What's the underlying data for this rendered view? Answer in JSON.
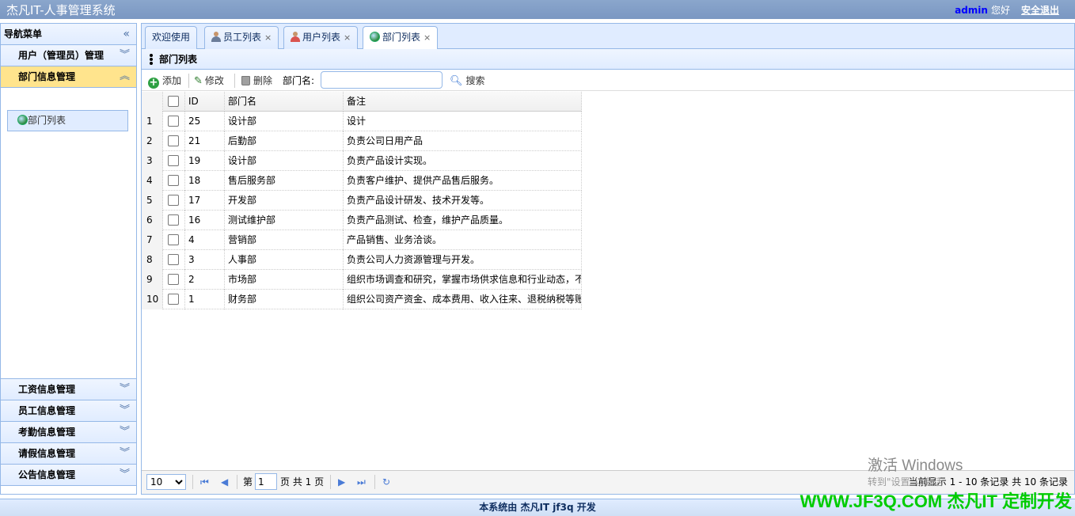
{
  "header": {
    "title": "杰凡IT-人事管理系统",
    "user": "admin",
    "greeting": "您好",
    "logout": "安全退出"
  },
  "sidebar": {
    "title": "导航菜单",
    "sections": [
      {
        "label": "用户（管理员）管理"
      },
      {
        "label": "部门信息管理",
        "active": true,
        "items": [
          {
            "label": "部门列表",
            "icon": "globe-icon"
          }
        ]
      },
      {
        "label": "工资信息管理"
      },
      {
        "label": "员工信息管理"
      },
      {
        "label": "考勤信息管理"
      },
      {
        "label": "请假信息管理"
      },
      {
        "label": "公告信息管理"
      }
    ]
  },
  "tabs": [
    {
      "label": "欢迎使用",
      "closable": false
    },
    {
      "label": "员工列表",
      "closable": true,
      "icon": "person-icon"
    },
    {
      "label": "用户列表",
      "closable": true,
      "icon": "person-icon"
    },
    {
      "label": "部门列表",
      "closable": true,
      "icon": "globe-icon",
      "selected": true
    }
  ],
  "close_symbol": "×",
  "panel": {
    "title": "部门列表"
  },
  "toolbar": {
    "add": "添加",
    "edit": "修改",
    "delete": "删除",
    "search_label": "部门名:",
    "search_value": "",
    "search_button": "搜索"
  },
  "grid": {
    "columns": [
      "ID",
      "部门名",
      "备注"
    ],
    "rows": [
      {
        "n": "1",
        "id": "25",
        "name": "设计部",
        "note": "设计"
      },
      {
        "n": "2",
        "id": "21",
        "name": "后勤部",
        "note": "负责公司日用产品"
      },
      {
        "n": "3",
        "id": "19",
        "name": "设计部",
        "note": "负责产品设计实现。"
      },
      {
        "n": "4",
        "id": "18",
        "name": "售后服务部",
        "note": "负责客户维护、提供产品售后服务。"
      },
      {
        "n": "5",
        "id": "17",
        "name": "开发部",
        "note": "负责产品设计研发、技术开发等。"
      },
      {
        "n": "6",
        "id": "16",
        "name": "测试维护部",
        "note": "负责产品测试、检查，维护产品质量。"
      },
      {
        "n": "7",
        "id": "4",
        "name": "营销部",
        "note": "产品销售、业务洽谈。"
      },
      {
        "n": "8",
        "id": "3",
        "name": "人事部",
        "note": "负责公司人力资源管理与开发。"
      },
      {
        "n": "9",
        "id": "2",
        "name": "市场部",
        "note": "组织市场调查和研究，掌握市场供求信息和行业动态，不"
      },
      {
        "n": "10",
        "id": "1",
        "name": "财务部",
        "note": "组织公司资产资金、成本费用、收入往来、退税纳税等账"
      }
    ]
  },
  "pager": {
    "page_size": "10",
    "page_prefix": "第",
    "page_input": "1",
    "page_suffix": "页 共 1 页",
    "info": "当前显示 1 - 10 条记录 共 10 条记录"
  },
  "footer": {
    "text": "本系统由 杰凡IT jf3q 开发"
  },
  "overlay": {
    "activate_title": "激活 Windows",
    "activate_sub": "转到\"设置\"以激活",
    "brand": "WWW.JF3Q.COM 杰凡IT  定制开发"
  },
  "colors": {
    "header": "#7a97c2",
    "border": "#95b8e7",
    "active_section": "#ffe48d",
    "brand": "#00cc00"
  }
}
